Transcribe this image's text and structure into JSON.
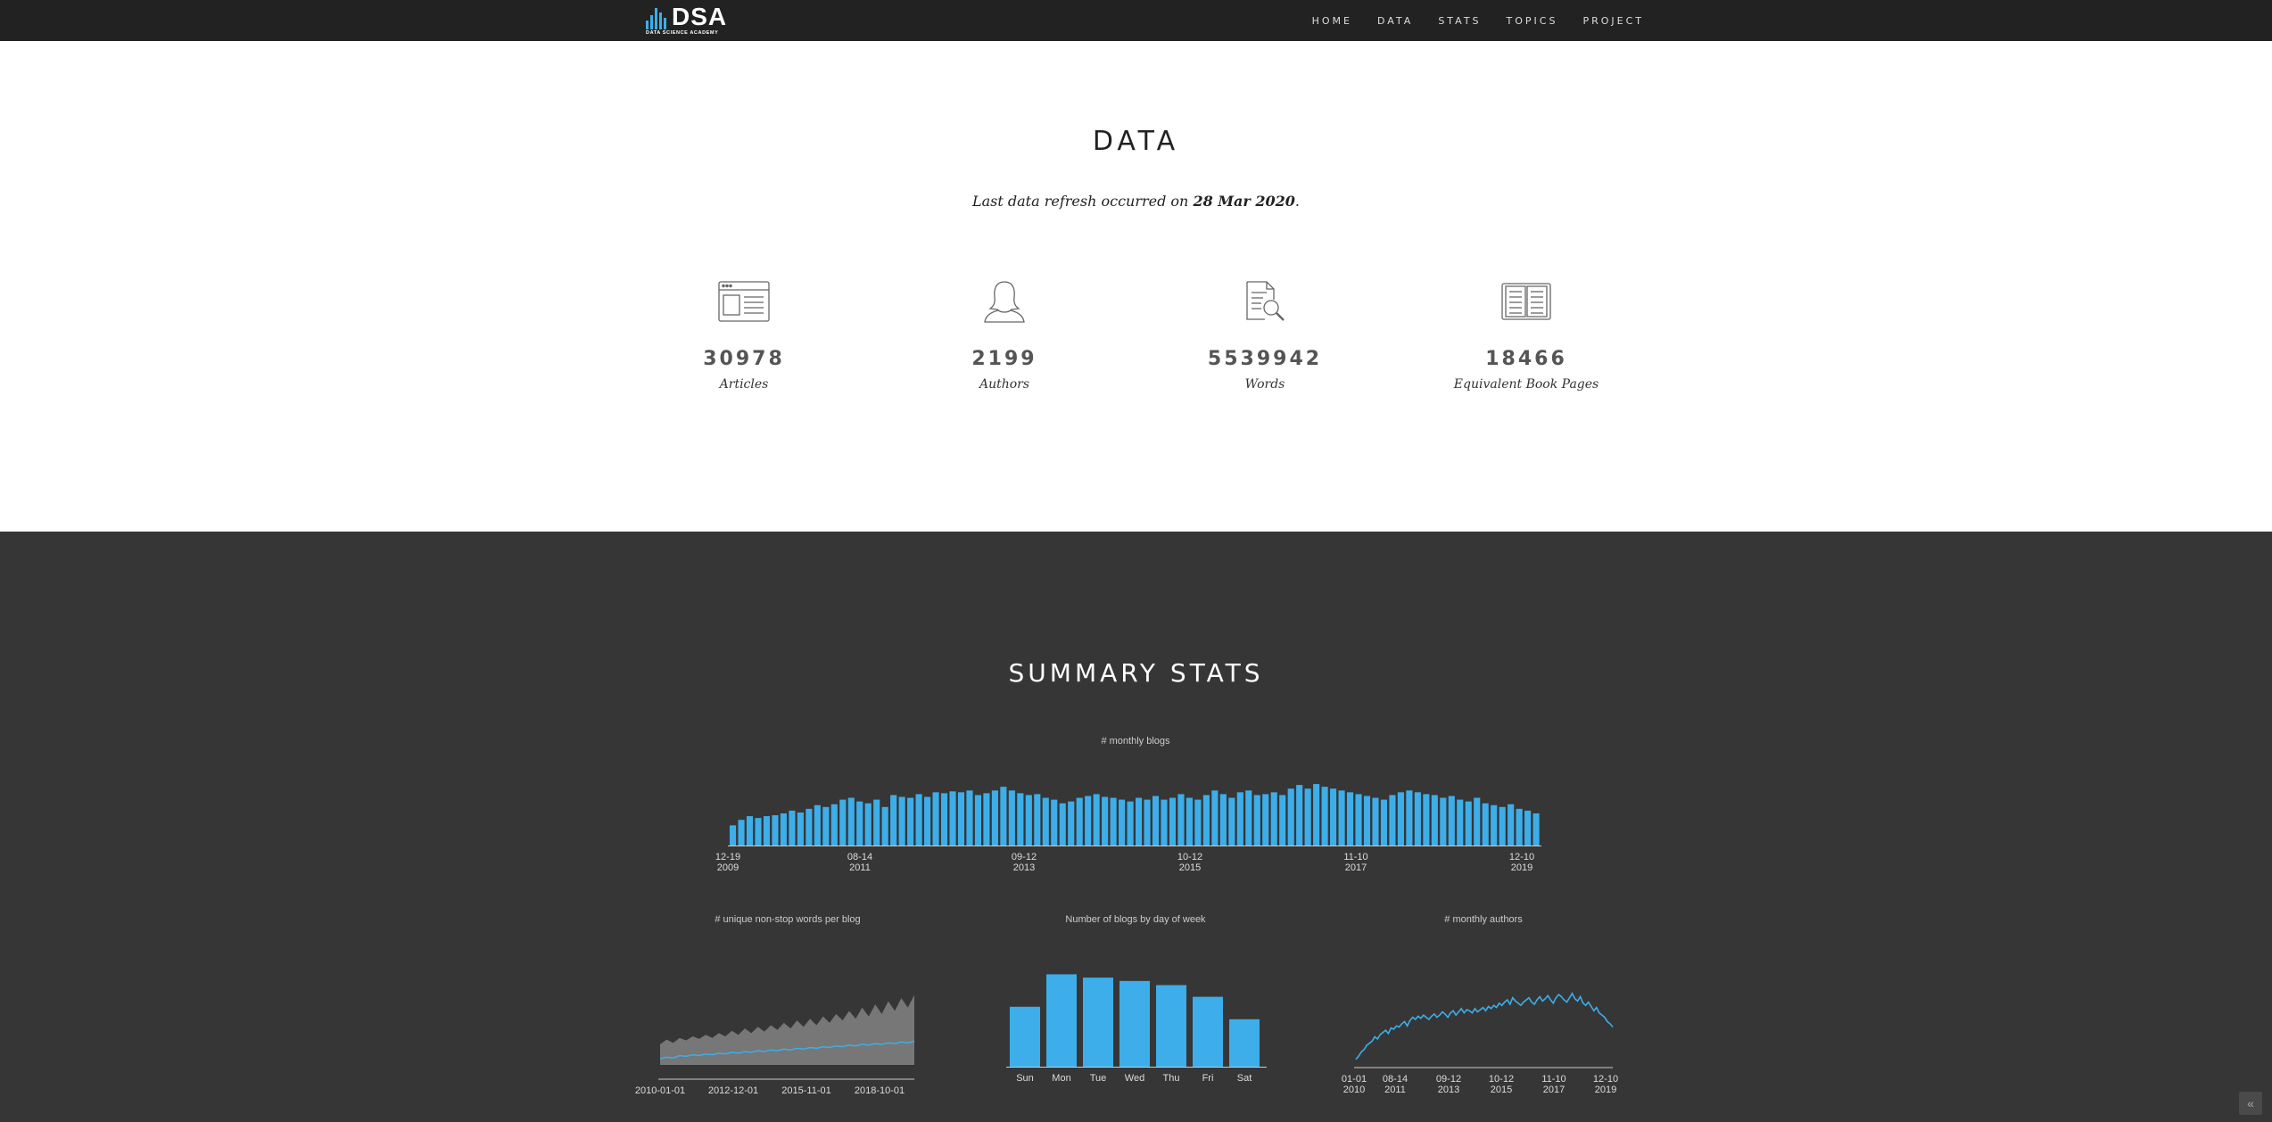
{
  "nav": {
    "logo_text": "DSA",
    "logo_subtext": "DATA SCIENCE ACADEMY",
    "items": [
      "HOME",
      "DATA",
      "STATS",
      "TOPICS",
      "PROJECT"
    ]
  },
  "data_section": {
    "title": "DATA",
    "refresh_prefix": "Last data refresh occurred on ",
    "refresh_date": "28 Mar 2020",
    "refresh_suffix": ".",
    "stats": [
      {
        "icon": "article-icon",
        "value": "30978",
        "label": "Articles"
      },
      {
        "icon": "author-icon",
        "value": "2199",
        "label": "Authors"
      },
      {
        "icon": "document-search-icon",
        "value": "5539942",
        "label": "Words"
      },
      {
        "icon": "open-book-icon",
        "value": "18466",
        "label": "Equivalent Book Pages"
      }
    ]
  },
  "summary": {
    "title": "SUMMARY STATS",
    "scroll_top_icon": "chevron-up-icon"
  },
  "colors": {
    "accent": "#3daee9",
    "nav_bg": "#222222",
    "summary_bg": "#363636",
    "area_fill": "#777777"
  },
  "chart_data": [
    {
      "type": "bar",
      "title": "# monthly blogs",
      "x_tick_labels": [
        [
          "12-19",
          "2009"
        ],
        [
          "08-14",
          "2011"
        ],
        [
          "09-12",
          "2013"
        ],
        [
          "10-12",
          "2015"
        ],
        [
          "11-10",
          "2017"
        ],
        [
          "12-10",
          "2019"
        ]
      ],
      "values": [
        22,
        28,
        32,
        30,
        32,
        33,
        35,
        38,
        36,
        40,
        44,
        42,
        45,
        50,
        52,
        48,
        46,
        50,
        42,
        55,
        53,
        52,
        56,
        53,
        58,
        57,
        59,
        58,
        60,
        55,
        57,
        60,
        64,
        60,
        57,
        55,
        56,
        52,
        50,
        46,
        48,
        52,
        54,
        56,
        53,
        52,
        50,
        48,
        52,
        50,
        54,
        50,
        52,
        56,
        52,
        50,
        55,
        60,
        56,
        52,
        58,
        60,
        55,
        56,
        58,
        55,
        62,
        66,
        62,
        67,
        64,
        62,
        60,
        58,
        56,
        54,
        52,
        50,
        55,
        58,
        60,
        58,
        56,
        55,
        52,
        54,
        50,
        48,
        52,
        46,
        44,
        42,
        45,
        40,
        38,
        35
      ],
      "ylim": [
        0,
        70
      ]
    },
    {
      "type": "area",
      "title": "# unique non-stop words per blog",
      "x_tick_labels": [
        "2010-01-01",
        "2012-12-01",
        "2015-11-01",
        "2018-10-01"
      ],
      "series": [
        {
          "values": [
            10,
            12,
            11,
            14,
            13,
            15,
            14,
            16,
            15,
            17,
            16,
            18,
            17,
            19,
            18,
            20,
            19,
            21,
            20,
            22,
            21,
            23,
            22,
            24,
            23,
            25,
            24,
            26,
            25,
            27,
            26,
            28,
            27,
            29,
            28,
            30,
            29,
            31,
            30,
            32
          ]
        },
        {
          "values": [
            28,
            34,
            30,
            36,
            33,
            38,
            35,
            40,
            36,
            42,
            38,
            45,
            40,
            48,
            42,
            50,
            44,
            52,
            46,
            55,
            48,
            58,
            50,
            60,
            52,
            63,
            55,
            66,
            58,
            70,
            60,
            74,
            63,
            78,
            66,
            82,
            70,
            86,
            74,
            90
          ]
        }
      ]
    },
    {
      "type": "bar",
      "title": "Number of blogs by day of week",
      "categories": [
        "Sun",
        "Mon",
        "Tue",
        "Wed",
        "Thu",
        "Fri",
        "Sat"
      ],
      "values": [
        3600,
        5550,
        5350,
        5150,
        4900,
        4200,
        2850
      ],
      "ylim": [
        0,
        6000
      ]
    },
    {
      "type": "line",
      "title": "# monthly authors",
      "x_tick_labels": [
        [
          "01-01",
          "2010"
        ],
        [
          "08-14",
          "2011"
        ],
        [
          "09-12",
          "2013"
        ],
        [
          "10-12",
          "2015"
        ],
        [
          "11-10",
          "2017"
        ],
        [
          "12-10",
          "2019"
        ]
      ],
      "values": [
        5,
        8,
        12,
        14,
        18,
        20,
        22,
        26,
        24,
        28,
        30,
        32,
        29,
        34,
        33,
        36,
        35,
        38,
        40,
        36,
        41,
        44,
        42,
        45,
        43,
        46,
        44,
        42,
        45,
        47,
        44,
        46,
        49,
        47,
        44,
        48,
        50,
        46,
        49,
        52,
        48,
        51,
        50,
        48,
        52,
        49,
        51,
        53,
        50,
        54,
        52,
        55,
        53,
        57,
        55,
        58,
        60,
        56,
        62,
        59,
        57,
        55,
        58,
        60,
        62,
        58,
        56,
        60,
        63,
        59,
        61,
        64,
        60,
        57,
        62,
        65,
        63,
        60,
        58,
        62,
        66,
        61,
        59,
        63,
        57,
        55,
        58,
        54,
        50,
        53,
        48,
        46,
        44,
        40,
        38,
        35
      ],
      "ylim": [
        0,
        70
      ]
    }
  ]
}
